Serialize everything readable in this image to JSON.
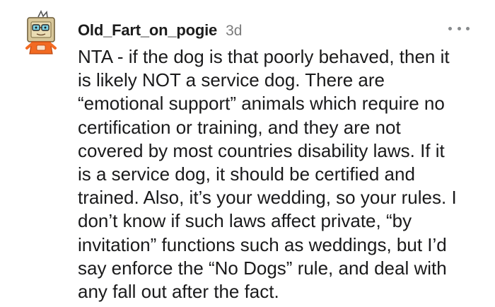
{
  "comment": {
    "username": "Old_Fart_on_pogie",
    "timestamp": "3d",
    "lines": [
      "NTA - if the dog is that poorly behaved, then it",
      "is likely NOT a service dog. There are",
      "“emotional support” animals which require no",
      "certification or training, and they are not",
      "covered by most countries disability laws. If it",
      "is a service dog, it should be certified and",
      "trained. Also, it’s your wedding, so your rules. I",
      "don’t know if such laws affect private, “by",
      "invitation” functions such as weddings, but I’d",
      "say enforce the “No Dogs” rule, and deal with",
      "any fall out after the fact."
    ]
  },
  "icons": {
    "avatar": "user-avatar-icon",
    "more": "more-options-icon"
  },
  "colors": {
    "username": "#1c1c1c",
    "timestamp": "#7c7c7c",
    "body": "#1a1a1b",
    "more_dots": "#878a8c"
  }
}
